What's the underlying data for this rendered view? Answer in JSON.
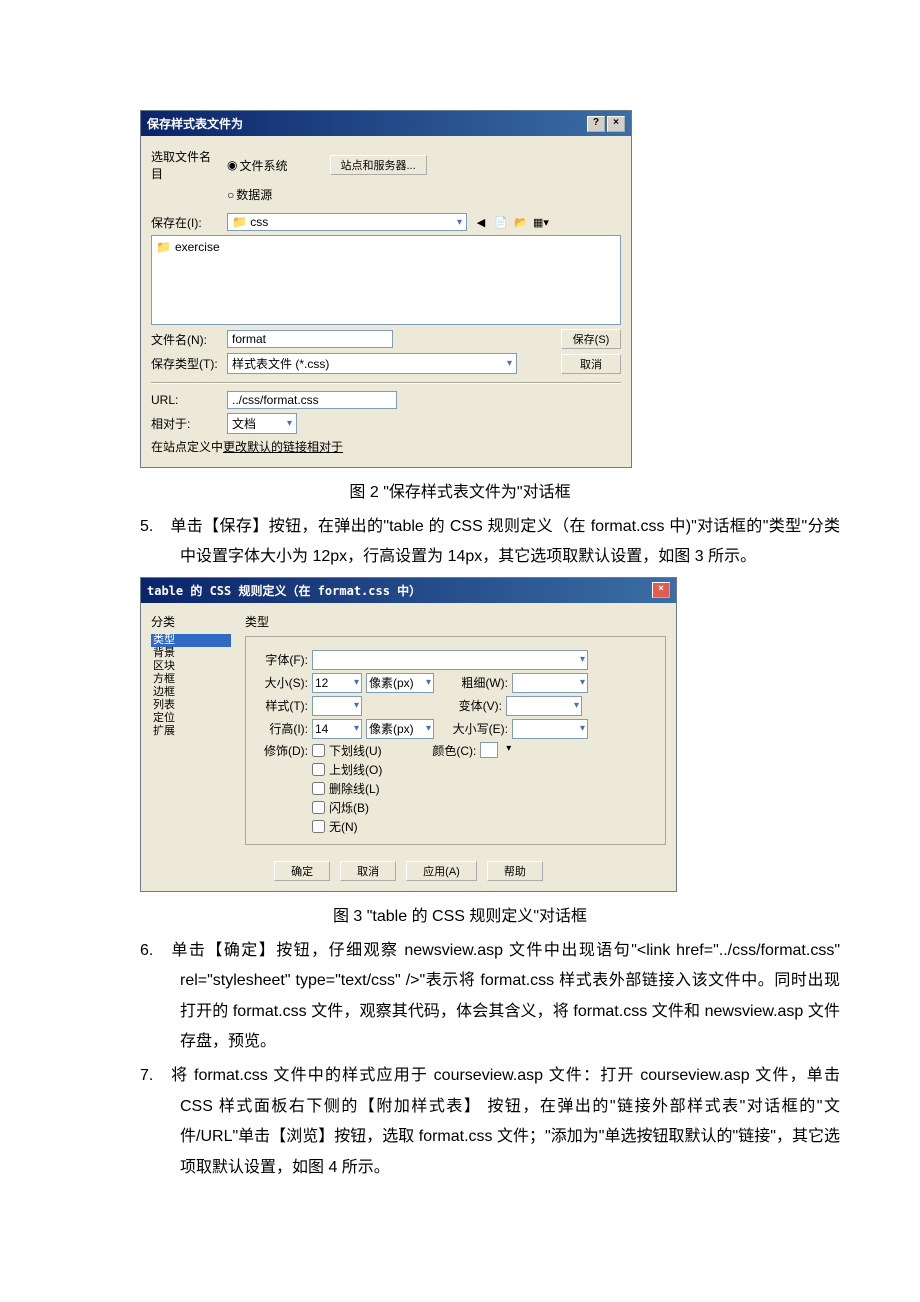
{
  "dlg1": {
    "title": "保存样式表文件为",
    "selectLabel": "选取文件名目",
    "radioFile": "文件系统",
    "radioData": "数据源",
    "siteBtn": "站点和服务器...",
    "saveInLabel": "保存在(I):",
    "folder": "css",
    "listItem": "exercise",
    "fileNameLabel": "文件名(N):",
    "fileName": "format",
    "saveTypeLabel": "保存类型(T):",
    "saveType": "样式表文件 (*.css)",
    "saveBtn": "保存(S)",
    "cancelBtn": "取消",
    "urlLabel": "URL:",
    "url": "../css/format.css",
    "relLabel": "相对于:",
    "rel": "文档",
    "note": "在站点定义中",
    "noteLink": "更改默认的链接相对于"
  },
  "cap2": "图 2 \"保存样式表文件为\"对话框",
  "p5": "单击【保存】按钮，在弹出的\"table 的 CSS 规则定义（在 format.css 中)\"对话框的\"类型\"分类中设置字体大小为 12px，行高设置为 14px，其它选项取默认设置，如图 3 所示。",
  "dlg2": {
    "title": "table 的 CSS 规则定义（在 format.css 中）",
    "catHd": "分类",
    "cats": [
      "类型",
      "背景",
      "区块",
      "方框",
      "边框",
      "列表",
      "定位",
      "扩展"
    ],
    "typeHd": "类型",
    "fontLbl": "字体(F):",
    "sizeLbl": "大小(S):",
    "sizeVal": "12",
    "sizeUnit": "像素(px)",
    "weightLbl": "粗细(W):",
    "styleLbl": "样式(T):",
    "variantLbl": "变体(V):",
    "lineLbl": "行高(I):",
    "lineVal": "14",
    "lineUnit": "像素(px)",
    "caseLbl": "大小写(E):",
    "decoLbl": "修饰(D):",
    "decos": [
      "下划线(U)",
      "上划线(O)",
      "删除线(L)",
      "闪烁(B)",
      "无(N)"
    ],
    "colorLbl": "颜色(C):",
    "okBtn": "确定",
    "cancelBtn": "取消",
    "applyBtn": "应用(A)",
    "helpBtn": "帮助"
  },
  "cap3": "图 3 \"table 的 CSS 规则定义\"对话框",
  "p6": "单击【确定】按钮，仔细观察 newsview.asp 文件中出现语句\"<link href=\"../css/format.css\" rel=\"stylesheet\" type=\"text/css\" />\"表示将 format.css 样式表外部链接入该文件中。同时出现打开的 format.css 文件，观察其代码，体会其含义，将 format.css 文件和 newsview.asp 文件存盘，预览。",
  "p7": "将 format.css 文件中的样式应用于 courseview.asp 文件：打开 courseview.asp 文件，单击 CSS 样式面板右下侧的【附加样式表】 按钮，在弹出的\"链接外部样式表\"对话框的\"文件/URL\"单击【浏览】按钮，选取 format.css 文件；\"添加为\"单选按钮取默认的\"链接\"，其它选项取默认设置，如图 4 所示。"
}
